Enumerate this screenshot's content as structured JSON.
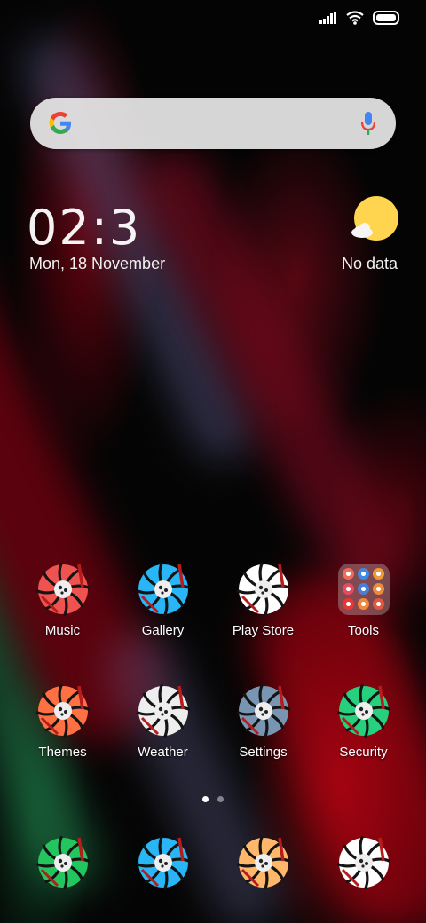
{
  "status_bar": {
    "icons": [
      "signal-icon",
      "wifi-icon",
      "battery-icon"
    ]
  },
  "search_bar": {
    "logo": "google-logo",
    "mic_icon": "mic-icon"
  },
  "clock_widget": {
    "time": "02:3",
    "date": "Mon, 18 November"
  },
  "weather_widget": {
    "icon": "partly-cloudy-icon",
    "status": "No data"
  },
  "home_rows": [
    [
      {
        "label": "Music",
        "color": "#ef5350"
      },
      {
        "label": "Gallery",
        "color": "#29b6f6"
      },
      {
        "label": "Play Store",
        "color": "#ffffff"
      },
      {
        "label": "Tools",
        "folder": true
      }
    ],
    [
      {
        "label": "Themes",
        "color": "#ff7043"
      },
      {
        "label": "Weather",
        "color": "#eeeeee"
      },
      {
        "label": "Settings",
        "color": "#7895b2"
      },
      {
        "label": "Security",
        "color": "#26d07c"
      }
    ]
  ],
  "folder_icons": [
    "#ef6c57",
    "#3f8ae0",
    "#ef9a3a",
    "#e84a5f",
    "#4a7fd8",
    "#ef8a3a",
    "#e53935",
    "#f08a3a",
    "#e2583e"
  ],
  "page_indicator": {
    "count": 2,
    "active": 0
  },
  "dock": [
    {
      "color": "#22c55e"
    },
    {
      "color": "#29b6f6"
    },
    {
      "color": "#ffb86b"
    },
    {
      "color": "#ffffff"
    }
  ]
}
